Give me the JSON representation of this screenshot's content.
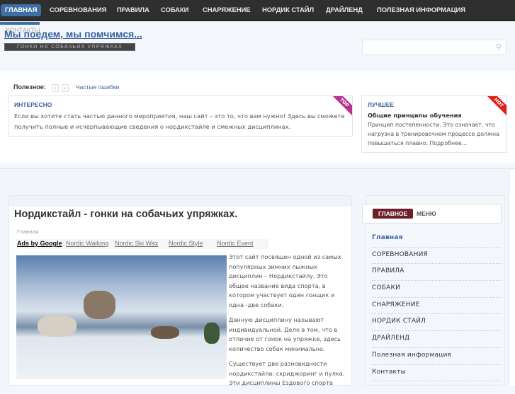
{
  "nav": {
    "items": [
      "ГЛАВНАЯ",
      "СОРЕВНОВАНИЯ",
      "ПРАВИЛА",
      "СОБАКИ",
      "СНАРЯЖЕНИЕ",
      "НОРДИК СТАЙЛ",
      "ДРАЙЛЕНД",
      "ПОЛЕЗНАЯ ИНФОРМАЦИЯ"
    ],
    "overflow_item": "КОНТАКТЫ"
  },
  "header": {
    "title": "Мы поедем, мы помчимся...",
    "tagline": "ГОНКИ НА СОБАЧЬИХ УПРЯЖКАХ",
    "search_placeholder": "",
    "search_icon": "search-icon"
  },
  "useful": {
    "label": "Полезное:",
    "link": "Частые ошибки",
    "prev": "‹",
    "next": "›"
  },
  "boxes": [
    {
      "heading": "ИНТЕРЕСНО",
      "badge": "TOP",
      "badge_color": "#b8328f",
      "text": "Если вы хотите стать частью данного мероприятия, наш сайт – это то, что вам нужно! Здесь вы сможете получить полные и исчерпывающие сведения о нордикстайле и смежных дисциплинах."
    },
    {
      "heading": "ЛУЧШЕЕ",
      "badge": "HOT",
      "badge_color": "#e0201a",
      "subtitle": "Общие принципы обучения",
      "text": "Принцип постепенности. Это означает, что нагрузка в тренировочном процессе должна повышаться плавно. Подробнее..."
    }
  ],
  "article": {
    "title": "Нордикстайл - гонки на собачьих упряжках.",
    "breadcrumb": "Главная",
    "ads": [
      "Ads by Google",
      "Nordic Walking",
      "Nordic Ski Wax",
      "Nordic Style",
      "Nordic Event"
    ],
    "paragraphs": [
      "Этот сайт посвящен одной из самых популярных зимних лыжных дисциплин – Нордикстайлу. Это общее название вида спорта, в котором участвует один гонщик и одна -две собаки.",
      "Данную дисциплину называют индивидуальной. Дело в том, что в отличие от гонок на упряжке, здесь количество собак минимально.",
      "Существует две разновидности нордикстайла: скриджоринг и пулка. Эти дисциплины Ездового спорта"
    ]
  },
  "sidebar": {
    "head_badge": "ГЛАВНОЕ",
    "head_label": "МЕНЮ",
    "items": [
      "Главная",
      "СОРЕВНОВАНИЯ",
      "ПРАВИЛА",
      "СОБАКИ",
      "СНАРЯЖЕНИЕ",
      "НОРДИК СТАЙЛ",
      "ДРАЙЛЕНД",
      "Полезная информация",
      "Контакты"
    ]
  }
}
